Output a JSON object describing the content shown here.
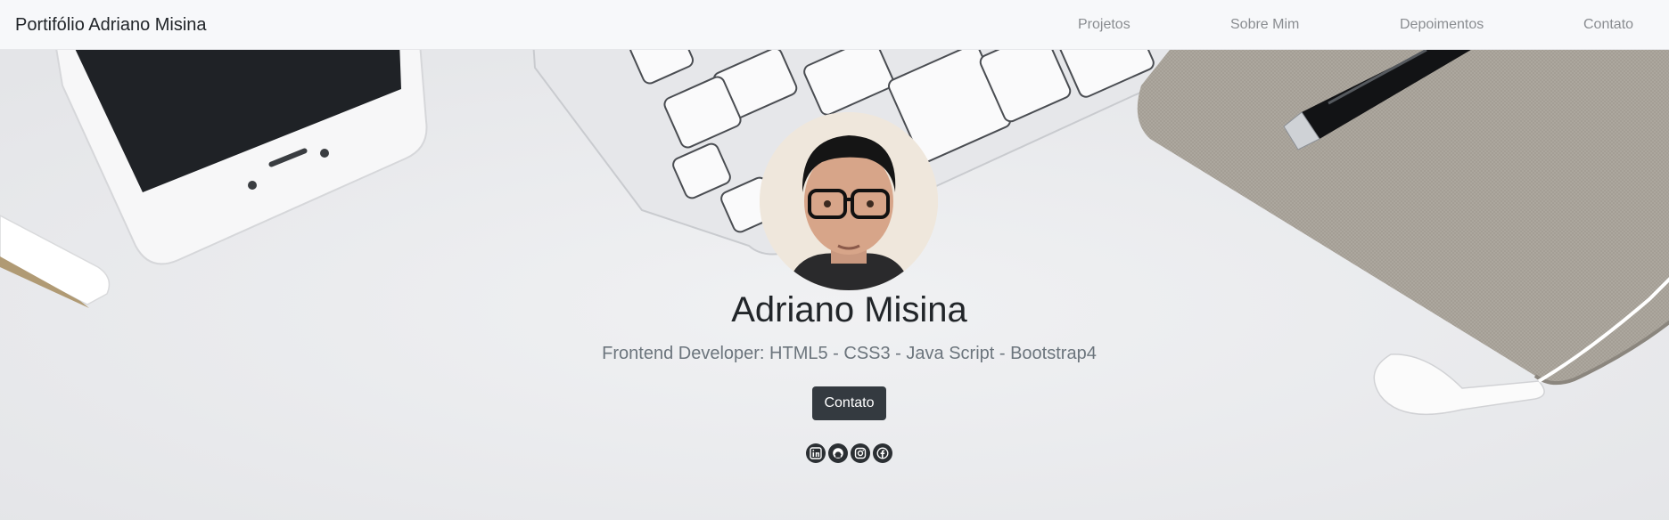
{
  "navbar": {
    "brand": "Portifólio Adriano Misina",
    "links": [
      "Projetos",
      "Sobre Mim",
      "Depoimentos",
      "Contato"
    ]
  },
  "hero": {
    "name": "Adriano Misina",
    "subtitle": "Frontend Developer: HTML5 - CSS3 - Java Script - Bootstrap4",
    "cta_label": "Contato",
    "social_icons": [
      "linkedin-icon",
      "github-icon",
      "instagram-icon",
      "facebook-icon"
    ]
  },
  "colors": {
    "navbar_bg": "#f7f8fa",
    "button_bg": "#343a40",
    "text_dark": "#212529",
    "text_muted": "#6c757d"
  }
}
